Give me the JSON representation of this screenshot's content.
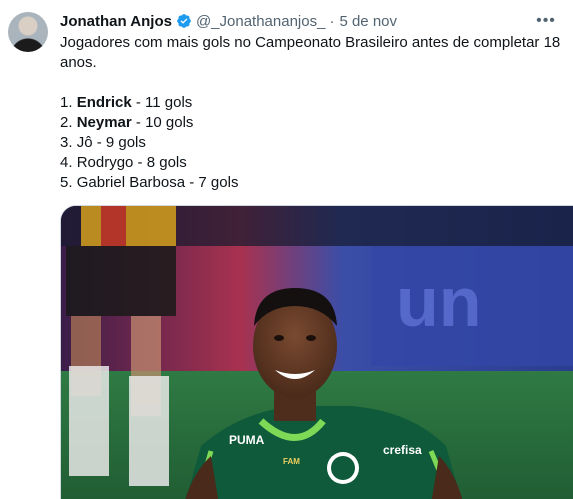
{
  "tweet": {
    "author_name": "Jonathan Anjos",
    "author_handle": "@_Jonathananjos_",
    "separator": "·",
    "date": "5 de nov",
    "more_label": "•••",
    "text_intro": "Jogadores com mais gols no Campeonato Brasileiro antes de completar 18 anos.",
    "list": [
      {
        "prefix": "1. ",
        "name": "Endrick",
        "suffix": " - 11 gols",
        "bold": true
      },
      {
        "prefix": "2. ",
        "name": "Neymar",
        "suffix": " - 10 gols",
        "bold": true
      },
      {
        "prefix": "3. ",
        "name": "Jô",
        "suffix": " - 9 gols",
        "bold": false
      },
      {
        "prefix": "4. ",
        "name": "Rodrygo",
        "suffix": " - 8 gols",
        "bold": false
      },
      {
        "prefix": "5. ",
        "name": "Gabriel Barbosa",
        "suffix": " - 7 gols",
        "bold": false
      }
    ]
  },
  "media": {
    "jersey_sponsors": [
      "PUMA",
      "crefisa",
      "FAM"
    ],
    "colors": {
      "verified_blue": "#1d9bf0",
      "jersey_green": "#0e5a3a",
      "jersey_accent": "#7ed957",
      "pitch": "#2e6b3c",
      "stand_blue": "#2a3d8f"
    }
  }
}
